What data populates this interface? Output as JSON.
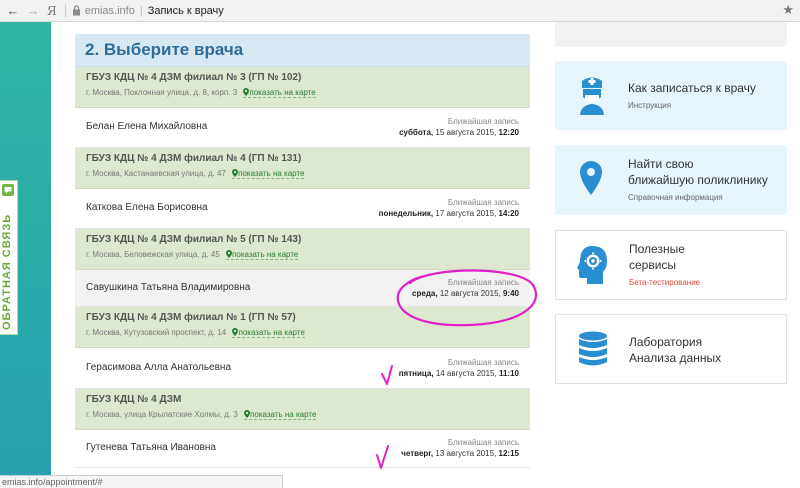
{
  "browser": {
    "back": "←",
    "forward": "→",
    "engine": "Я",
    "domain": "emias.info",
    "tab_title": "Запись к врачу",
    "status_url": "emias.info/appointment/#"
  },
  "feedback": {
    "label": "ОБРАТНАЯ СВЯЗЬ"
  },
  "section": {
    "title": "2. Выберите врача"
  },
  "map_link_label": "показать на карте",
  "appt_label": "Ближайшая запись",
  "clinics": [
    {
      "name": "ГБУЗ КДЦ № 4 ДЗМ филиал № 3 (ГП № 102)",
      "address": "г. Москва, Поклонная улица, д. 8, корп. 3",
      "doctor": "Белан Елена Михайловна",
      "day": "суббота,",
      "date": "15 августа 2015,",
      "time": "12:20"
    },
    {
      "name": "ГБУЗ КДЦ № 4 ДЗМ филиал № 4 (ГП № 131)",
      "address": "г. Москва, Кастанаевская улица, д. 47",
      "doctor": "Каткова Елена Борисовна",
      "day": "понедельник,",
      "date": "17 августа 2015,",
      "time": "14:20"
    },
    {
      "name": "ГБУЗ КДЦ № 4 ДЗМ филиал № 5 (ГП № 143)",
      "address": "г. Москва, Беловежская улица, д. 45",
      "doctor": "Савушкина Татьяна Владимировна",
      "day": "среда,",
      "date": "12 августа 2015,",
      "time": "9:40"
    },
    {
      "name": "ГБУЗ КДЦ № 4 ДЗМ филиал № 1 (ГП № 57)",
      "address": "г. Москва, Кутузовский проспект, д. 14",
      "doctor": "Герасимова Алла Анатольевна",
      "day": "пятница,",
      "date": "14 августа 2015,",
      "time": "11:10"
    },
    {
      "name": "ГБУЗ КДЦ № 4 ДЗМ",
      "address": "г. Москва, улица Крылатские Холмы, д. 3",
      "doctor": "Гутенева Татьяна Ивановна",
      "day": "четверг,",
      "date": "13 августа 2015,",
      "time": "12:15"
    }
  ],
  "cards": [
    {
      "icon": "doctor-icon",
      "title": "Как записаться к врачу",
      "subtitle": "Инструкция"
    },
    {
      "icon": "map-pin-icon",
      "title_line1": "Найти свою",
      "title_line2": "ближайшую поликлинику",
      "subtitle": "Справочная информация"
    },
    {
      "icon": "head-gear-icon",
      "title_line1": "Полезные",
      "title_line2": "сервисы",
      "subtitle": "Бета-тестирование"
    },
    {
      "icon": "database-icon",
      "title_line1": "Лаборатория",
      "title_line2": "Анализа данных"
    }
  ],
  "colors": {
    "teal": "#2db7a2",
    "title_blue": "#2e6e9a",
    "clinic_green": "#dde8d0",
    "annotation_magenta": "#e020c8",
    "card_icon_blue": "#2a8fd0"
  }
}
